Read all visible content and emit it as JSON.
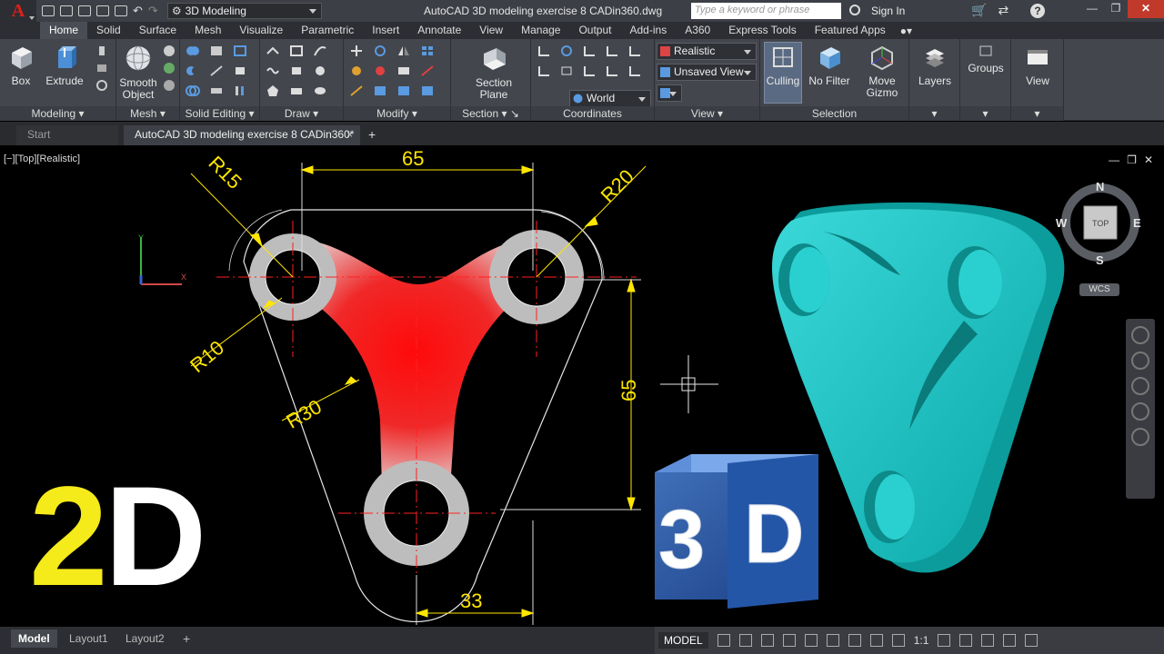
{
  "title_bar": {
    "workspace": "3D Modeling",
    "window_title": "AutoCAD 3D modeling exercise 8 CADin360.dwg",
    "search_placeholder": "Type a keyword or phrase",
    "sign_in": "Sign In"
  },
  "ribbon_tabs": [
    "Home",
    "Solid",
    "Surface",
    "Mesh",
    "Visualize",
    "Parametric",
    "Insert",
    "Annotate",
    "View",
    "Manage",
    "Output",
    "Add-ins",
    "A360",
    "Express Tools",
    "Featured Apps"
  ],
  "ribbon": {
    "box_label": "Box",
    "extrude_label": "Extrude",
    "smooth_object_label1": "Smooth",
    "smooth_object_label2": "Object",
    "section_plane_label1": "Section",
    "section_plane_label2": "Plane",
    "visual_style": "Realistic",
    "saved_view": "Unsaved View",
    "ucs": "World",
    "culling_label": "Culling",
    "no_filter_label": "No Filter",
    "move_gizmo_label1": "Move",
    "move_gizmo_label2": "Gizmo",
    "layers_label": "Layers",
    "groups_label": "Groups",
    "view_label": "View",
    "panels": {
      "modeling": "Modeling",
      "mesh": "Mesh",
      "solid_editing": "Solid Editing",
      "draw": "Draw",
      "modify": "Modify",
      "section": "Section",
      "coordinates": "Coordinates",
      "view": "View",
      "selection": "Selection"
    }
  },
  "doc_tabs": {
    "start": "Start",
    "file": "AutoCAD 3D modeling exercise 8 CADin360*"
  },
  "viewport": {
    "label": "[−][Top][Realistic]",
    "dimensions": {
      "r15": "R15",
      "top_65": "65",
      "r20": "R20",
      "r10": "R10",
      "r30": "R30",
      "right_65": "65",
      "bottom_33": "33"
    },
    "big_2d_two": "2",
    "big_2d_d": "D",
    "cube_3": "3",
    "cube_d": "D",
    "compass": {
      "n": "N",
      "s": "S",
      "e": "E",
      "w": "W",
      "face": "TOP"
    },
    "wcs": "WCS"
  },
  "status_bar": {
    "model_tab": "Model",
    "layout1": "Layout1",
    "layout2": "Layout2",
    "model_space": "MODEL",
    "scale": "1:1"
  },
  "colors": {
    "accent_red": "#ff1a1a",
    "dimension_yellow": "#ffe600",
    "solid_teal": "#1fc2c2"
  }
}
